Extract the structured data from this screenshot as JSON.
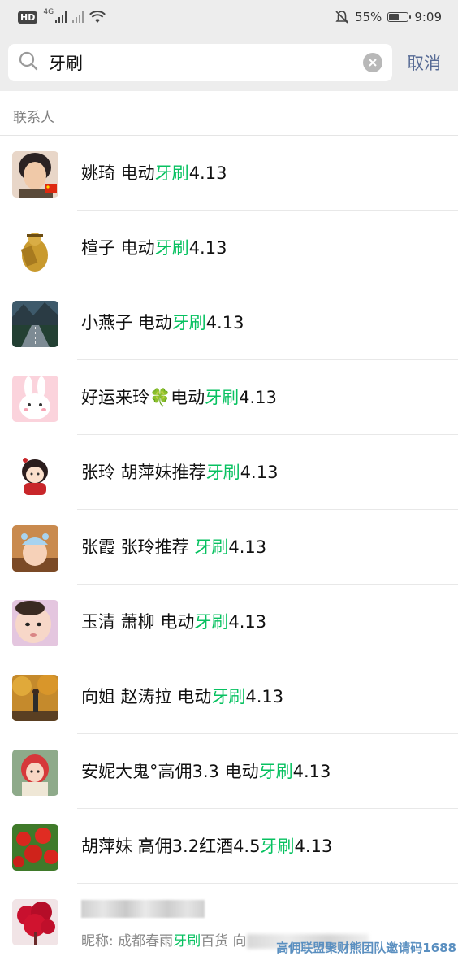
{
  "status_bar": {
    "network_hd": "HD",
    "network_type": "4G",
    "battery_percent": "55%",
    "battery_level": 0.55,
    "time": "9:09"
  },
  "search": {
    "query": "牙刷",
    "cancel_label": "取消"
  },
  "section": {
    "label": "联系人"
  },
  "highlight_color": "#07c160",
  "contacts": [
    {
      "prefix": "姚琦 电动",
      "match": "牙刷",
      "suffix": "4.13",
      "avatar": "avatar-photo-girl-flag"
    },
    {
      "prefix": "楦子 电动",
      "match": "牙刷",
      "suffix": "4.13",
      "avatar": "avatar-golden-statue"
    },
    {
      "prefix": "小燕子 电动",
      "match": "牙刷",
      "suffix": "4.13",
      "avatar": "avatar-road-landscape"
    },
    {
      "prefix": "好运来玲",
      "emoji": "🍀",
      "prefix2": "电动",
      "match": "牙刷",
      "suffix": "4.13",
      "avatar": "avatar-bunny-cartoon"
    },
    {
      "prefix": "张玲 胡萍妹推荐",
      "match": "牙刷",
      "suffix": "4.13",
      "avatar": "avatar-cartoon-girl"
    },
    {
      "prefix": "张霞 张玲推荐 ",
      "match": "牙刷",
      "suffix": "4.13",
      "avatar": "avatar-baby-hat"
    },
    {
      "prefix": "玉清 萧柳 电动",
      "match": "牙刷",
      "suffix": "4.13",
      "avatar": "avatar-baby-photo"
    },
    {
      "prefix": "向姐 赵涛拉 电动",
      "match": "牙刷",
      "suffix": "4.13",
      "avatar": "avatar-autumn-trees"
    },
    {
      "prefix": "安妮大鬼°高佣3.3 电动",
      "match": "牙刷",
      "suffix": "4.13",
      "avatar": "avatar-child-red-hood"
    },
    {
      "prefix": "胡萍妹 高佣3.2红酒4.5",
      "match": "牙刷",
      "suffix": "4.13",
      "avatar": "avatar-tomatoes"
    }
  ],
  "last_contact": {
    "nickname_prefix": "昵称: 成都春雨",
    "nickname_match": "牙刷",
    "nickname_suffix": "百货 向",
    "avatar": "avatar-red-tree"
  },
  "watermark": "高佣联盟聚财熊团队邀请码1688"
}
